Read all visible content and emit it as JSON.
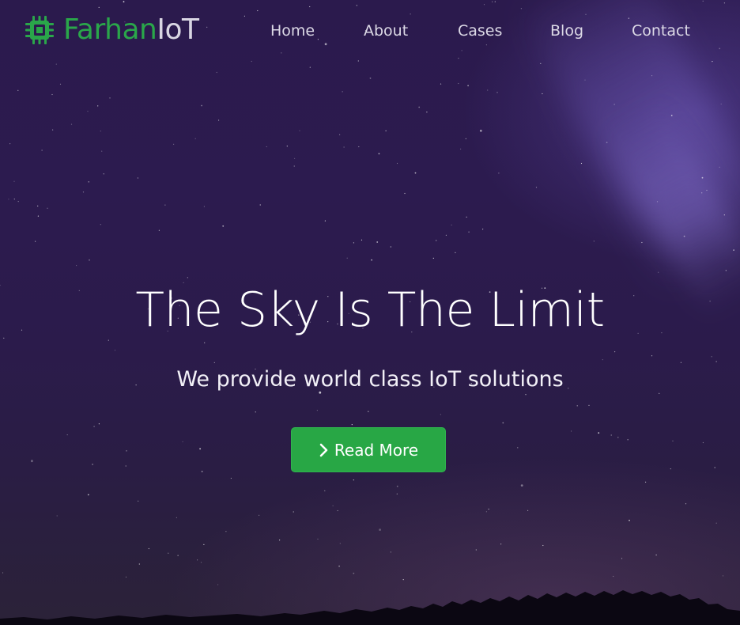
{
  "brand": {
    "name_part1": "Farhan",
    "name_part2": "IoT",
    "icon": "chip-icon",
    "accent_color": "#2aa64a"
  },
  "nav": {
    "items": [
      {
        "label": "Home"
      },
      {
        "label": "About"
      },
      {
        "label": "Cases"
      },
      {
        "label": "Blog"
      },
      {
        "label": "Contact"
      }
    ]
  },
  "hero": {
    "title": "The Sky Is The Limit",
    "subtitle": "We provide world class IoT solutions",
    "cta": {
      "label": "Read More",
      "icon": "chevron-right-icon",
      "color": "#28a745"
    }
  }
}
